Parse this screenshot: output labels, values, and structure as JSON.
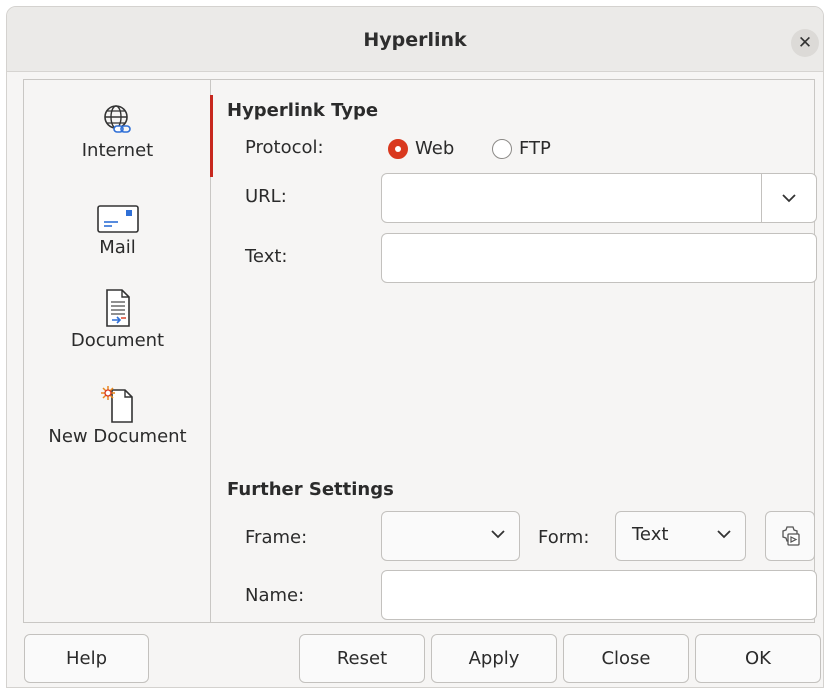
{
  "dialog": {
    "title": "Hyperlink"
  },
  "sidebar": {
    "items": [
      {
        "label": "Internet",
        "icon": "globe-link-icon"
      },
      {
        "label": "Mail",
        "icon": "envelope-icon"
      },
      {
        "label": "Document",
        "icon": "document-icon"
      },
      {
        "label": "New Document",
        "icon": "new-document-icon"
      }
    ],
    "active": "Internet"
  },
  "hyperlink_type": {
    "heading": "Hyperlink Type",
    "protocol_label": "Protocol:",
    "protocol_options": [
      "Web",
      "FTP"
    ],
    "protocol_selected": "Web",
    "url_label": "URL:",
    "url_value": "",
    "text_label": "Text:",
    "text_value": ""
  },
  "further_settings": {
    "heading": "Further Settings",
    "frame_label": "Frame:",
    "frame_value": "",
    "form_label": "Form:",
    "form_value": "Text",
    "name_label": "Name:",
    "name_value": "",
    "events_icon": "macro-events-icon"
  },
  "buttons": {
    "help": "Help",
    "reset": "Reset",
    "apply": "Apply",
    "close": "Close",
    "ok": "OK"
  },
  "colors": {
    "accent": "#d9381e",
    "active_bar": "#c7281e"
  }
}
